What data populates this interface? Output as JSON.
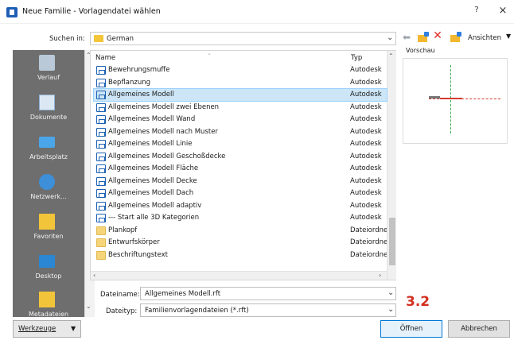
{
  "window": {
    "title": "Neue Familie - Vorlagendatei wählen",
    "help": "?",
    "close": "×"
  },
  "lookin": {
    "label": "Suchen in:",
    "value": "German"
  },
  "toolbar": {
    "views_label": "Ansichten"
  },
  "places": [
    {
      "label": "Verlauf",
      "icon": "history-icon"
    },
    {
      "label": "Dokumente",
      "icon": "documents-icon"
    },
    {
      "label": "Arbeitsplatz",
      "icon": "computer-icon"
    },
    {
      "label": "Netzwerk...",
      "icon": "network-icon"
    },
    {
      "label": "Favoriten",
      "icon": "favorites-icon"
    },
    {
      "label": "Desktop",
      "icon": "desktop-icon"
    },
    {
      "label": "Metadateien",
      "icon": "library-icon"
    }
  ],
  "filelist": {
    "columns": {
      "name": "Name",
      "type": "Typ"
    },
    "rows": [
      {
        "name": "Bewehrungsmuffe",
        "type": "Autodesk",
        "kind": "family"
      },
      {
        "name": "Bepflanzung",
        "type": "Autodesk",
        "kind": "family"
      },
      {
        "name": "Allgemeines Modell",
        "type": "Autodesk",
        "kind": "family",
        "selected": true
      },
      {
        "name": "Allgemeines Modell zwei Ebenen",
        "type": "Autodesk",
        "kind": "family"
      },
      {
        "name": "Allgemeines Modell Wand",
        "type": "Autodesk",
        "kind": "family"
      },
      {
        "name": "Allgemeines Modell nach Muster",
        "type": "Autodesk",
        "kind": "family"
      },
      {
        "name": "Allgemeines Modell Linie",
        "type": "Autodesk",
        "kind": "family"
      },
      {
        "name": "Allgemeines Modell Geschoßdecke",
        "type": "Autodesk",
        "kind": "family"
      },
      {
        "name": "Allgemeines Modell Fläche",
        "type": "Autodesk",
        "kind": "family"
      },
      {
        "name": "Allgemeines Modell Decke",
        "type": "Autodesk",
        "kind": "family"
      },
      {
        "name": "Allgemeines Modell Dach",
        "type": "Autodesk",
        "kind": "family"
      },
      {
        "name": "Allgemeines Modell adaptiv",
        "type": "Autodesk",
        "kind": "family"
      },
      {
        "name": "--- Start alle 3D Kategorien",
        "type": "Autodesk",
        "kind": "family"
      },
      {
        "name": "Plankopf",
        "type": "Dateiordne",
        "kind": "folder"
      },
      {
        "name": "Entwurfskörper",
        "type": "Dateiordne",
        "kind": "folder"
      },
      {
        "name": "Beschriftungstext",
        "type": "Dateiordne",
        "kind": "folder"
      }
    ]
  },
  "preview": {
    "label": "Vorschau"
  },
  "filename": {
    "label": "Dateiname:",
    "value": "Allgemeines Modell.rft"
  },
  "filetype": {
    "label": "Dateityp:",
    "value": "Familienvorlagendateien  (*.rft)"
  },
  "annotation": {
    "step": "3.2"
  },
  "buttons": {
    "tools": "Werkzeuge",
    "open": "Öffnen",
    "cancel": "Abbrechen"
  },
  "colors": {
    "selection": "#cde6f7",
    "places_bg": "#6e6e6e",
    "annotation": "#d32f1f",
    "delete_icon": "#e02b20"
  }
}
